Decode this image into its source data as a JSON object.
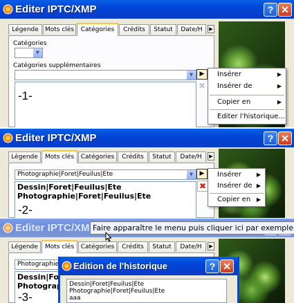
{
  "colors": {
    "titlebar": "#0046d8",
    "tab_highlight": "#ffc83c",
    "delete_red": "#e02020"
  },
  "panel1": {
    "title": "Editer IPTC/XMP",
    "tabs": [
      "Légende",
      "Mots clés",
      "Catégories",
      "Crédits",
      "Statut",
      "Date/H"
    ],
    "active_tab": "Catégories",
    "categories_label": "Catégories",
    "supp_label": "Catégories supplémentaires",
    "step": "-1-",
    "menu": [
      "Insérer",
      "Insérer de",
      "Copier en",
      "Editer l'historique..."
    ]
  },
  "panel2": {
    "title": "Editer IPTC/XMP",
    "tabs": [
      "Légende",
      "Mots clés",
      "Catégories",
      "Crédits",
      "Statut",
      "Date/H"
    ],
    "active_tab": "Mots clés",
    "combo_value": "Photographie|Foret|Feuilus|Ete",
    "lines": [
      "Dessin|Foret|Feuilus|Ete",
      "Photographie|Foret|Feuilus|Ete"
    ],
    "step": "-2-",
    "menu": [
      "Insérer",
      "Insérer de",
      "Copier en"
    ]
  },
  "panel3": {
    "title": "Editer IPTC/XMP",
    "tooltip": "Faire apparaître le menu puis cliquer ici par exemple",
    "tabs": [
      "Légende",
      "Mots clés",
      "Catégories",
      "Crédits",
      "Statut",
      "Date/H"
    ],
    "active_tab": "Mots clés",
    "combo_value": "Photographie|Foret",
    "lines": [
      "Dessin|For",
      "Photograph"
    ],
    "step": "-3-",
    "dialog": {
      "title": "Edition de l'historique",
      "lines": [
        "Dessin|Foret|Feuilus|Ete",
        "Photographie|Foret|Feuilus|Ete",
        "aaa"
      ]
    }
  }
}
